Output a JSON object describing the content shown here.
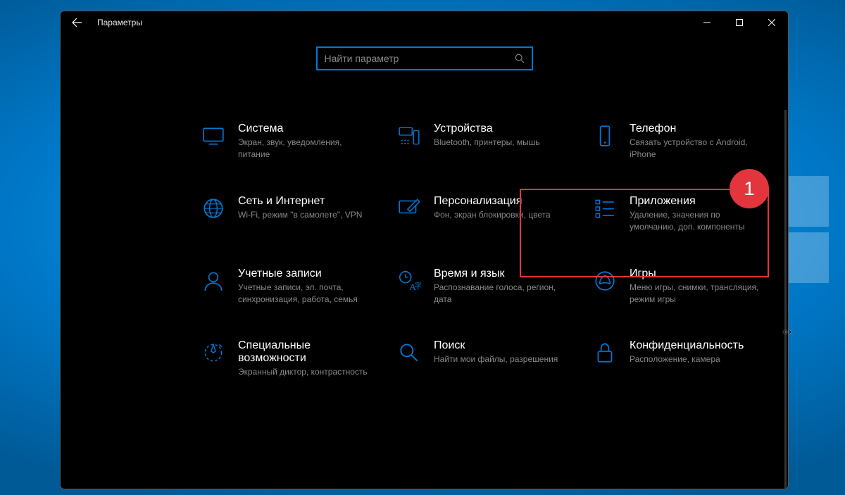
{
  "window": {
    "title": "Параметры"
  },
  "search": {
    "placeholder": "Найти параметр"
  },
  "categories": {
    "system": {
      "title": "Система",
      "desc": "Экран, звук, уведомления, питание"
    },
    "devices": {
      "title": "Устройства",
      "desc": "Bluetooth, принтеры, мышь"
    },
    "phone": {
      "title": "Телефон",
      "desc": "Связать устройство с Android, iPhone"
    },
    "network": {
      "title": "Сеть и Интернет",
      "desc": "Wi-Fi, режим \"в самолете\", VPN"
    },
    "personal": {
      "title": "Персонализация",
      "desc": "Фон, экран блокировки, цвета"
    },
    "apps": {
      "title": "Приложения",
      "desc": "Удаление, значения по умолчанию, доп. компоненты"
    },
    "accounts": {
      "title": "Учетные записи",
      "desc": "Учетные записи, эл. почта, синхронизация, работа, семья"
    },
    "time": {
      "title": "Время и язык",
      "desc": "Распознавание голоса, регион, дата"
    },
    "gaming": {
      "title": "Игры",
      "desc": "Меню игры, снимки, трансляция, режим игры"
    },
    "accessibility": {
      "title": "Специальные возможности",
      "desc": "Экранный диктор, контрастность"
    },
    "search_cat": {
      "title": "Поиск",
      "desc": "Найти мои файлы, разрешения"
    },
    "privacy": {
      "title": "Конфиденциальность",
      "desc": "Расположение, камера"
    }
  },
  "annotation": {
    "badge": "1"
  }
}
